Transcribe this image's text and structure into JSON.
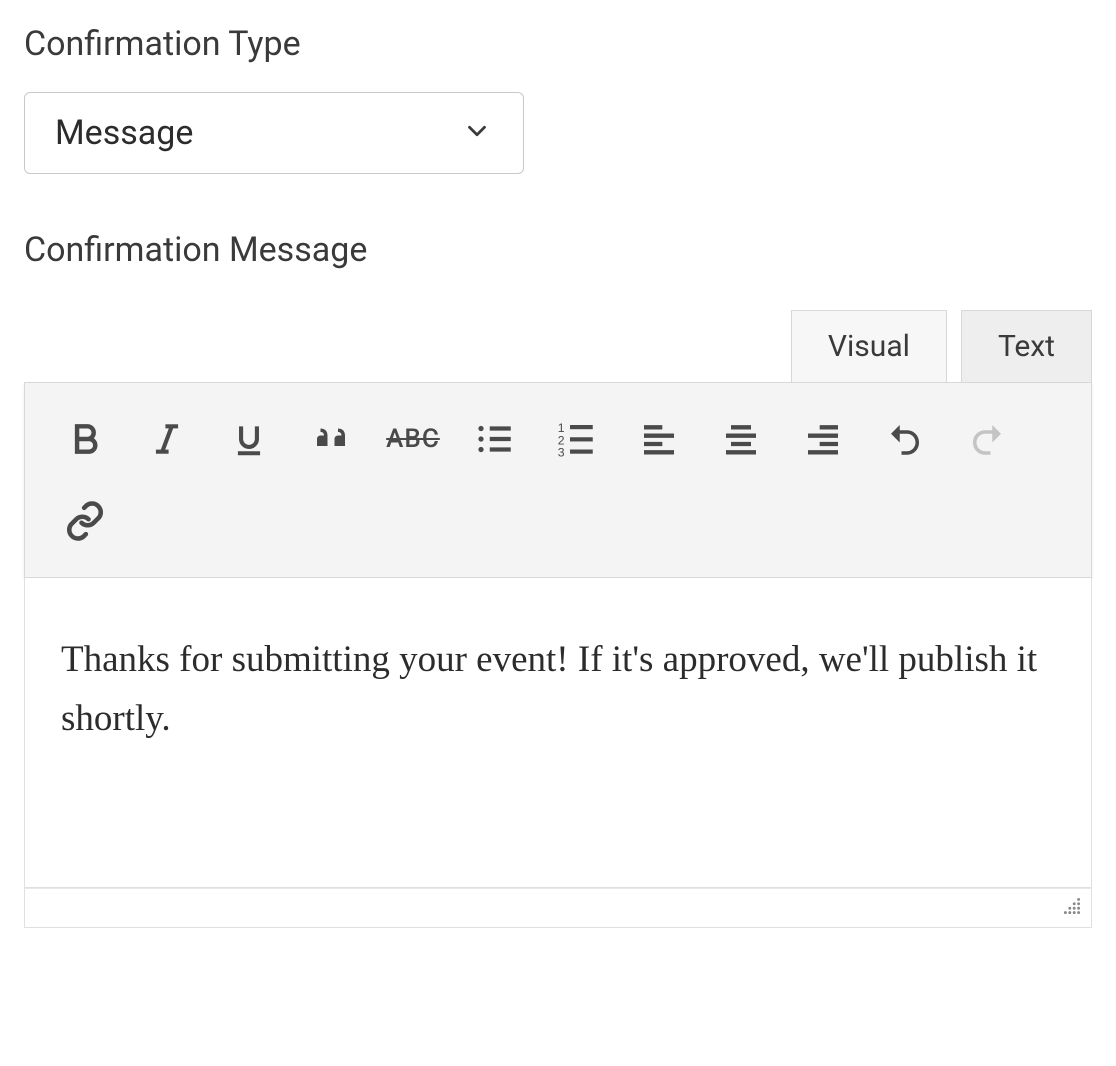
{
  "fields": {
    "type_label": "Confirmation Type",
    "type_value": "Message",
    "message_label": "Confirmation Message"
  },
  "editor": {
    "tabs": {
      "visual": "Visual",
      "text": "Text"
    },
    "content": "Thanks for submitting your event! If it's approved, we'll publish it shortly.",
    "toolbar": {
      "bold": "Bold",
      "italic": "Italic",
      "underline": "Underline",
      "blockquote": "Blockquote",
      "strikethrough_label": "ABC",
      "bulleted_list": "Bulleted list",
      "numbered_list": "Numbered list",
      "align_left": "Align left",
      "align_center": "Align center",
      "align_right": "Align right",
      "undo": "Undo",
      "redo": "Redo",
      "link": "Insert link"
    }
  }
}
